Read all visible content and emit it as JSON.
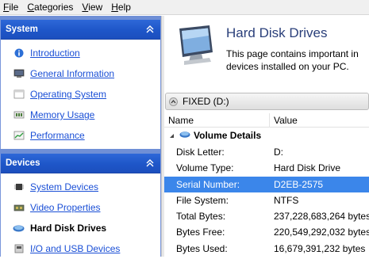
{
  "menu": [
    {
      "mnemonic": "F",
      "rest": "ile"
    },
    {
      "mnemonic": "C",
      "rest": "ategories"
    },
    {
      "mnemonic": "V",
      "rest": "iew"
    },
    {
      "mnemonic": "H",
      "rest": "elp"
    }
  ],
  "sidebar": {
    "system": {
      "title": "System",
      "items": [
        {
          "label": "Introduction",
          "icon": "info-icon"
        },
        {
          "label": "General Information",
          "icon": "computer-icon"
        },
        {
          "label": "Operating System",
          "icon": "window-icon"
        },
        {
          "label": "Memory Usage",
          "icon": "memory-icon"
        },
        {
          "label": "Performance",
          "icon": "chart-icon"
        }
      ]
    },
    "devices": {
      "title": "Devices",
      "items": [
        {
          "label": "System Devices",
          "icon": "chip-icon"
        },
        {
          "label": "Video Properties",
          "icon": "video-card-icon"
        },
        {
          "label": "Hard Disk Drives",
          "icon": "disk-icon",
          "active": true
        },
        {
          "label": "I/O and USB Devices",
          "icon": "usb-icon"
        }
      ]
    }
  },
  "main": {
    "title": "Hard Disk Drives",
    "description_line1": "This page contains important in",
    "description_line2": "devices installed on your PC.",
    "drive_label": "FIXED (D:)",
    "col_name": "Name",
    "col_value": "Value",
    "group_title": "Volume Details",
    "rows": [
      {
        "key": "Disk Letter:",
        "value": "D:"
      },
      {
        "key": "Volume Type:",
        "value": "Hard Disk Drive"
      },
      {
        "key": "Serial Number:",
        "value": "D2EB-2575",
        "selected": true
      },
      {
        "key": "File System:",
        "value": "NTFS"
      },
      {
        "key": "Total Bytes:",
        "value": "237,228,683,264 bytes"
      },
      {
        "key": "Bytes Free:",
        "value": "220,549,292,032 bytes"
      },
      {
        "key": "Bytes Used:",
        "value": "16,679,391,232 bytes"
      }
    ]
  },
  "colors": {
    "section_header": "#1e56c8",
    "link": "#1a4fd6",
    "selection": "#3b86ea",
    "title": "#2a3f7a"
  }
}
